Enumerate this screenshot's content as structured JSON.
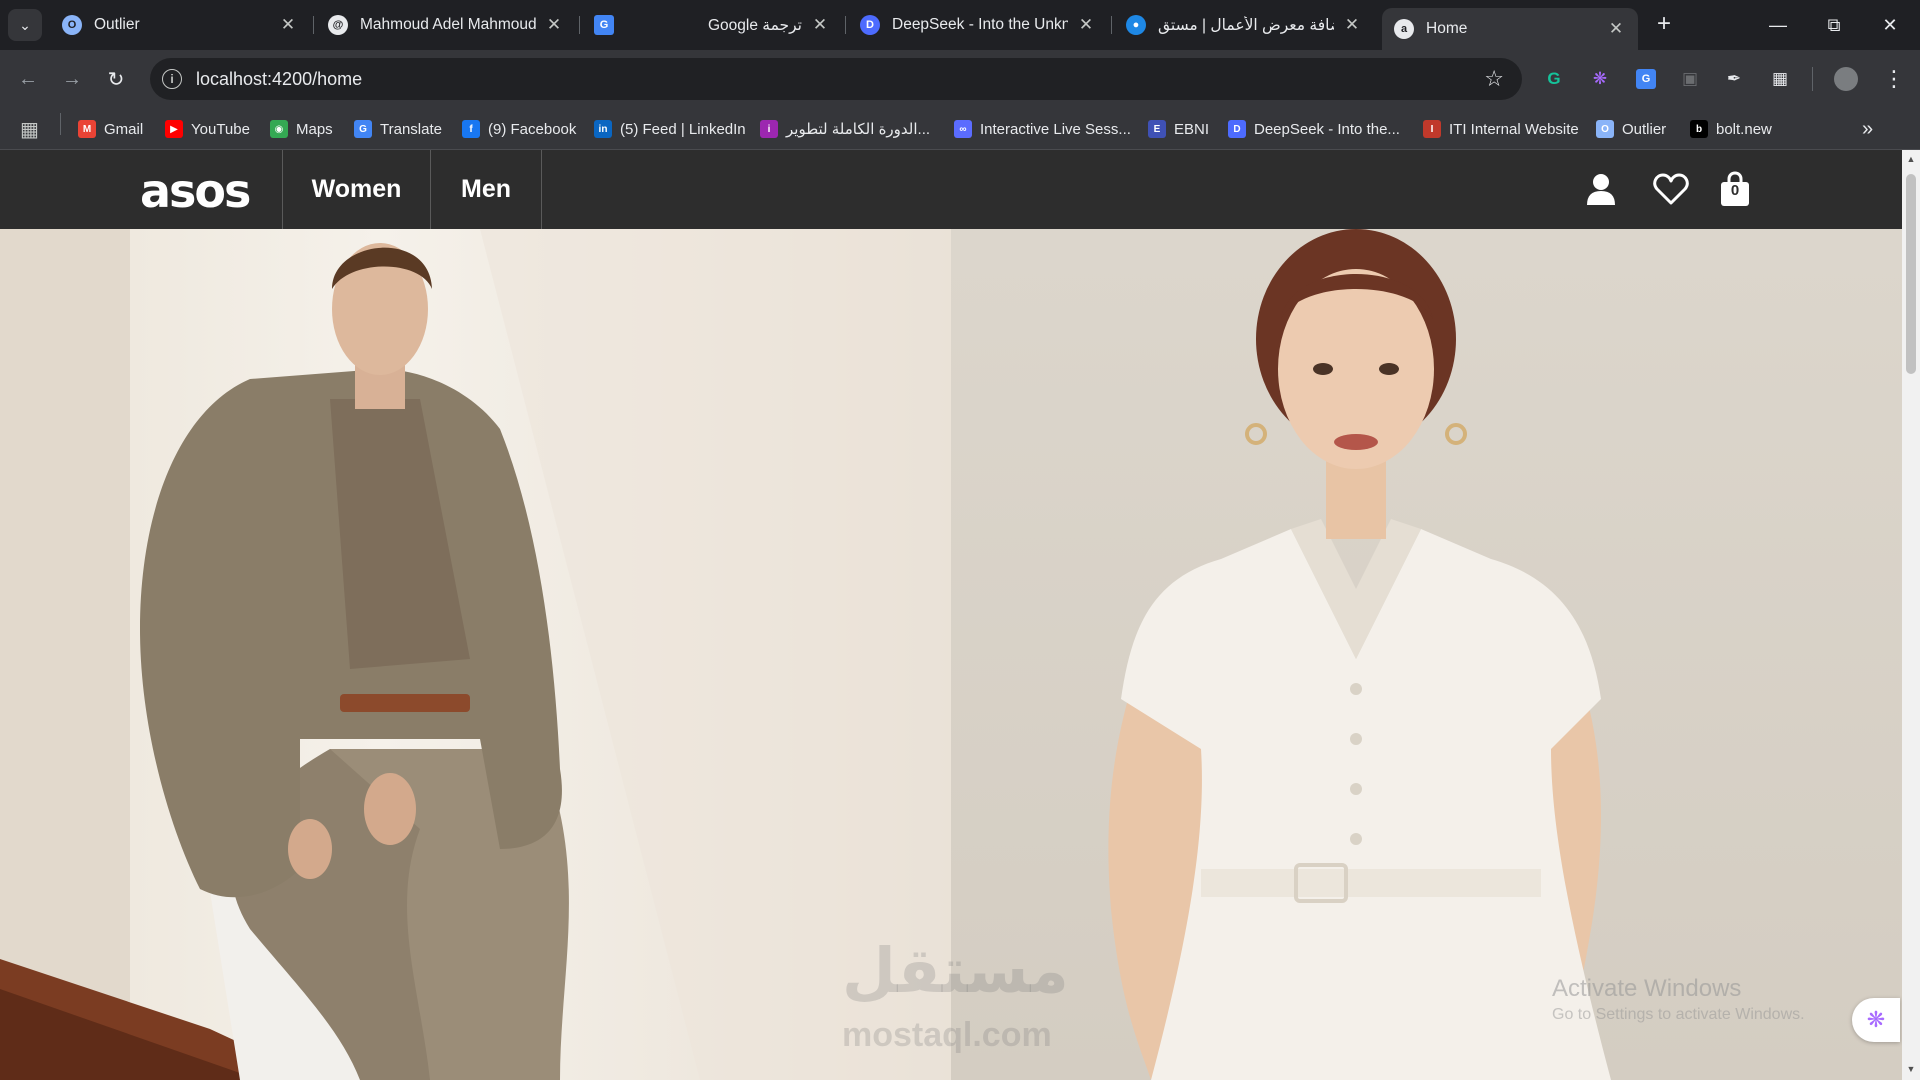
{
  "browser": {
    "tabs": [
      {
        "title": "Outlier",
        "icon": "outlier-icon",
        "active": false
      },
      {
        "title": "Mahmoud Adel Mahmoud",
        "icon": "threads-icon",
        "active": false
      },
      {
        "title": "Google ترجمة",
        "icon": "google-translate-icon",
        "active": false
      },
      {
        "title": "DeepSeek - Into the Unkno",
        "icon": "deepseek-icon",
        "active": false
      },
      {
        "title": "إضافة معرض الأعمال | مستق",
        "icon": "mostaql-icon",
        "active": false
      },
      {
        "title": "Home",
        "icon": "asos-icon",
        "active": true
      }
    ],
    "address_bar": {
      "url": "localhost:4200/home"
    },
    "bookmarks": [
      {
        "label": "Gmail",
        "icon": "gmail-icon",
        "color": "#ea4335"
      },
      {
        "label": "YouTube",
        "icon": "youtube-icon",
        "color": "#ff0000"
      },
      {
        "label": "Maps",
        "icon": "maps-icon",
        "color": "#34a853"
      },
      {
        "label": "Translate",
        "icon": "translate-icon",
        "color": "#4285f4"
      },
      {
        "label": "(9) Facebook",
        "icon": "facebook-icon",
        "color": "#1877f2"
      },
      {
        "label": "(5) Feed | LinkedIn",
        "icon": "linkedin-icon",
        "color": "#0a66c2"
      },
      {
        "label": "الدورة الكاملة لتطوير...",
        "icon": "course-icon",
        "color": "#9c27b0"
      },
      {
        "label": "Interactive Live Sess...",
        "icon": "live-session-icon",
        "color": "#5b6cff"
      },
      {
        "label": "EBNI",
        "icon": "ebni-icon",
        "color": "#3f51b5"
      },
      {
        "label": "DeepSeek - Into the...",
        "icon": "deepseek-icon",
        "color": "#4d6bfe"
      },
      {
        "label": "ITI Internal Website",
        "icon": "iti-icon",
        "color": "#c0392b"
      },
      {
        "label": "Outlier",
        "icon": "outlier-icon",
        "color": "#8ab4f8"
      },
      {
        "label": "bolt.new",
        "icon": "bolt-icon",
        "color": "#000000"
      }
    ]
  },
  "page": {
    "logo": "asos",
    "nav": [
      {
        "label": "Women"
      },
      {
        "label": "Men"
      }
    ],
    "cart_count": "0",
    "hero": [
      {
        "name": "men-hero-image",
        "icon": "man-in-suit-photo"
      },
      {
        "name": "women-hero-image",
        "icon": "woman-in-white-dress-photo"
      }
    ]
  },
  "overlays": {
    "watermark_arabic": "مستقل",
    "watermark_latin": "mostaql.com",
    "activate_title": "Activate Windows",
    "activate_sub": "Go to Settings to activate Windows."
  },
  "colors": {
    "chrome_bg": "#1f2024",
    "toolbar_bg": "#35363a",
    "asos_nav_bg": "#2d2d2d",
    "text_light": "#e8eaed"
  }
}
